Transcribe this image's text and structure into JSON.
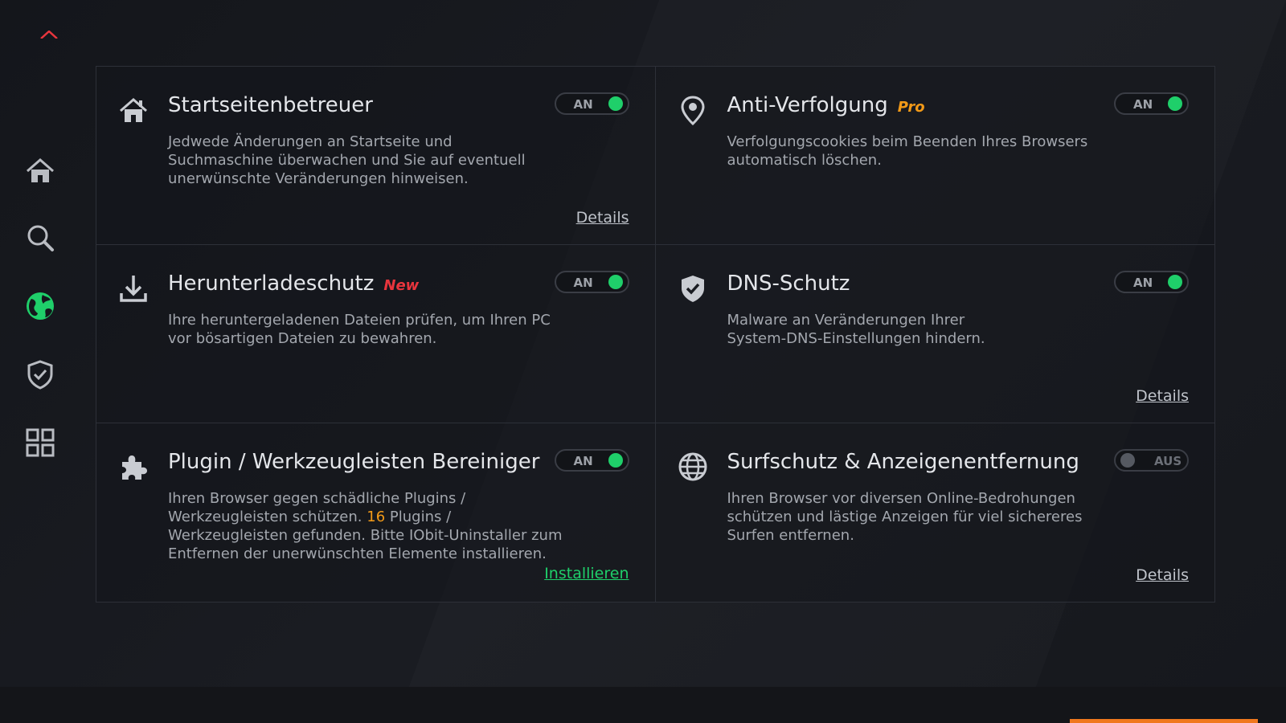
{
  "sidebar": {
    "items": [
      {
        "name": "home",
        "icon": "home-icon",
        "active": false
      },
      {
        "name": "search",
        "icon": "search-icon",
        "active": false
      },
      {
        "name": "browser-protection",
        "icon": "globe-icon",
        "active": true
      },
      {
        "name": "security",
        "icon": "shield-icon",
        "active": false
      },
      {
        "name": "tools",
        "icon": "grid-icon",
        "active": false
      }
    ]
  },
  "colors": {
    "accent_green": "#1fcf6a",
    "badge_new": "#e8353d",
    "badge_pro": "#f29a18",
    "footer_button": "#f0781e"
  },
  "cards": [
    {
      "id": "homepage",
      "icon": "home-icon",
      "title": "Startseitenbetreuer",
      "badge": "",
      "desc_lines": [
        "Jedwede Änderungen an Startseite und",
        "Suchmaschine überwachen und Sie auf eventuell",
        "unerwünschte Veränderungen hinweisen."
      ],
      "toggle": "AN",
      "link": "Details"
    },
    {
      "id": "anti-tracking",
      "icon": "location-pin-icon",
      "title": "Anti-Verfolgung",
      "badge": "Pro",
      "desc_lines": [
        "Verfolgungscookies beim Beenden Ihres Browsers",
        "automatisch löschen."
      ],
      "toggle": "AN",
      "link": ""
    },
    {
      "id": "download",
      "icon": "download-icon",
      "title": "Herunterladeschutz",
      "badge": "New",
      "desc_lines": [
        "Ihre heruntergeladenen Dateien prüfen, um Ihren PC",
        "vor bösartigen Dateien zu bewahren."
      ],
      "toggle": "AN",
      "link": ""
    },
    {
      "id": "dns",
      "icon": "shield-check-icon",
      "title": "DNS-Schutz",
      "badge": "",
      "desc_lines": [
        "Malware an Veränderungen Ihrer",
        "System-DNS-Einstellungen hindern."
      ],
      "toggle": "AN",
      "link": "Details"
    },
    {
      "id": "plugin",
      "icon": "puzzle-icon",
      "title": "Plugin / Werkzeugleisten Bereiniger",
      "badge": "",
      "desc_parts": {
        "before": "Ihren Browser gegen schädliche Plugins /",
        "line2_before": "Werkzeugleisten schützen. ",
        "count": "16",
        "line2_after": " Plugins /",
        "line3": "Werkzeugleisten gefunden. Bitte IObit-Uninstaller zum",
        "line4": "Entfernen der unerwünschten Elemente installieren."
      },
      "toggle": "AN",
      "link": "Installieren"
    },
    {
      "id": "surf",
      "icon": "globe-icon",
      "title": "Surfschutz & Anzeigenentfernung",
      "badge": "",
      "desc_lines": [
        "Ihren Browser vor diversen Online-Bedrohungen",
        "schützen und lästige Anzeigen für viel sichereres",
        "Surfen entfernen."
      ],
      "toggle": "AUS",
      "link": "Details"
    }
  ]
}
